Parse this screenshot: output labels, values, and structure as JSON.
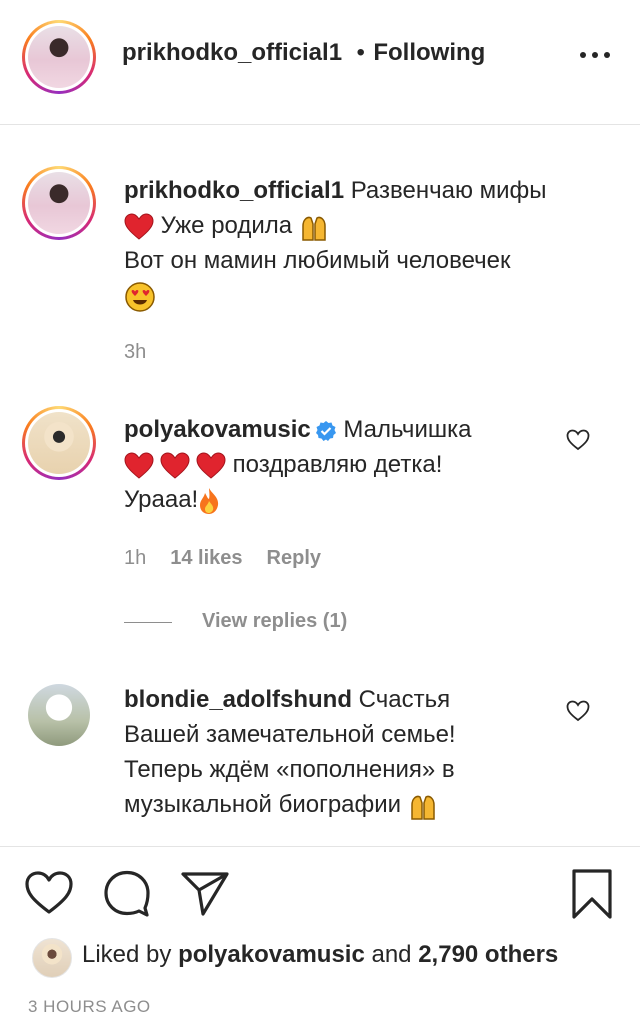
{
  "header": {
    "username": "prikhodko_official1",
    "separator": "•",
    "follow_status": "Following",
    "more_icon": "more-horizontal-icon"
  },
  "comments": [
    {
      "username": "prikhodko_official1",
      "lines": [
        "Развенчаю мифы",
        "Уже родила",
        "Вот он мамин любимый человечек"
      ],
      "time": "3h"
    },
    {
      "username": "polyakovamusic",
      "verified": true,
      "lines": [
        "Мальчишка",
        "поздравляю детка!",
        "Урааа!"
      ],
      "time": "1h",
      "likes": "14 likes",
      "reply": "Reply",
      "view_replies": "View replies (1)"
    },
    {
      "username": "blondie_adolfshund",
      "lines": [
        "Счастья",
        "Вашей замечательной семье!",
        "Теперь ждём «пополнения» в",
        "музыкальной биографии"
      ]
    }
  ],
  "footer": {
    "liked_by_prefix": "Liked by",
    "liked_by_user": "polyakovamusic",
    "liked_by_and": "and",
    "liked_by_others": "2,790 others",
    "time_ago": "3 HOURS AGO"
  },
  "colors": {
    "text": "#262626",
    "muted": "#8e8e8e",
    "heart_red": "#e0242e",
    "verified_blue": "#3897f0"
  }
}
